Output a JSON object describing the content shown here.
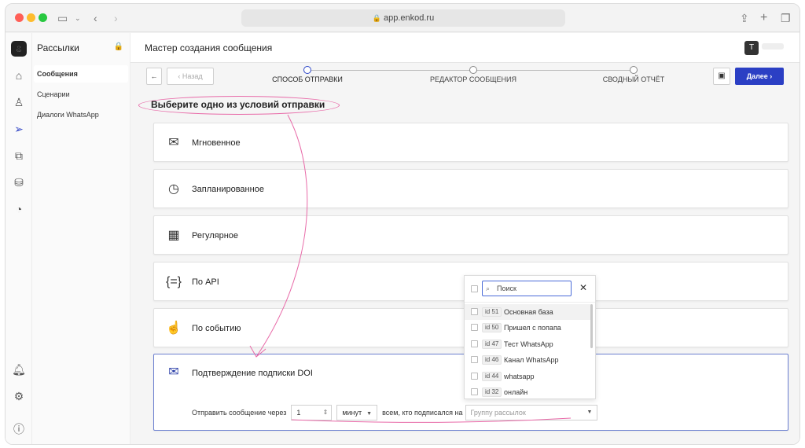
{
  "browser": {
    "url": "app.enkod.ru"
  },
  "rail": {
    "icons": [
      "logo-icon",
      "home-icon",
      "user-icon",
      "send-icon",
      "copy-icon",
      "bag-icon",
      "pie-chart-icon",
      "bell-icon",
      "settings-icon",
      "help-icon"
    ]
  },
  "sidebar": {
    "title": "Рассылки",
    "items": [
      {
        "label": "Сообщения",
        "active": true
      },
      {
        "label": "Сценарии",
        "active": false
      },
      {
        "label": "Диалоги WhatsApp",
        "active": false
      }
    ]
  },
  "header": {
    "title": "Мастер создания сообщения",
    "avatar_initial": "T"
  },
  "stepper": {
    "back_label": "Назад",
    "steps": [
      "СПОСОБ ОТПРАВКИ",
      "РЕДАКТОР СООБЩЕНИЯ",
      "СВОДНЫЙ ОТЧЁТ"
    ],
    "next_label": "Далее"
  },
  "section_title": "Выберите одно из условий отправки",
  "options": [
    {
      "label": "Мгновенное",
      "icon": "envelope-fast-icon"
    },
    {
      "label": "Запланированное",
      "icon": "clock-icon"
    },
    {
      "label": "Регулярное",
      "icon": "calendar-icon"
    },
    {
      "label": "По API",
      "icon": "api-braces-icon"
    },
    {
      "label": "По событию",
      "icon": "cursor-click-icon"
    },
    {
      "label": "Подтверждение подписки DOI",
      "icon": "mail-check-icon"
    }
  ],
  "doi": {
    "prefix": "Отправить сообщение через",
    "amount": "1",
    "unit": "минут",
    "middle": "всем, кто подписался на",
    "group_placeholder": "Группу рассылок"
  },
  "dropdown": {
    "search_placeholder": "Поиск",
    "items": [
      {
        "id": "id 51",
        "name": "Основная база"
      },
      {
        "id": "id 50",
        "name": "Пришел с попапа"
      },
      {
        "id": "id 47",
        "name": "Тест WhatsApp"
      },
      {
        "id": "id 46",
        "name": "Канал WhatsApp"
      },
      {
        "id": "id 44",
        "name": "whatsapp"
      },
      {
        "id": "id 32",
        "name": "онлайн"
      }
    ]
  },
  "colors": {
    "accent": "#2b3fc4",
    "annotation": "#e86aa8"
  }
}
